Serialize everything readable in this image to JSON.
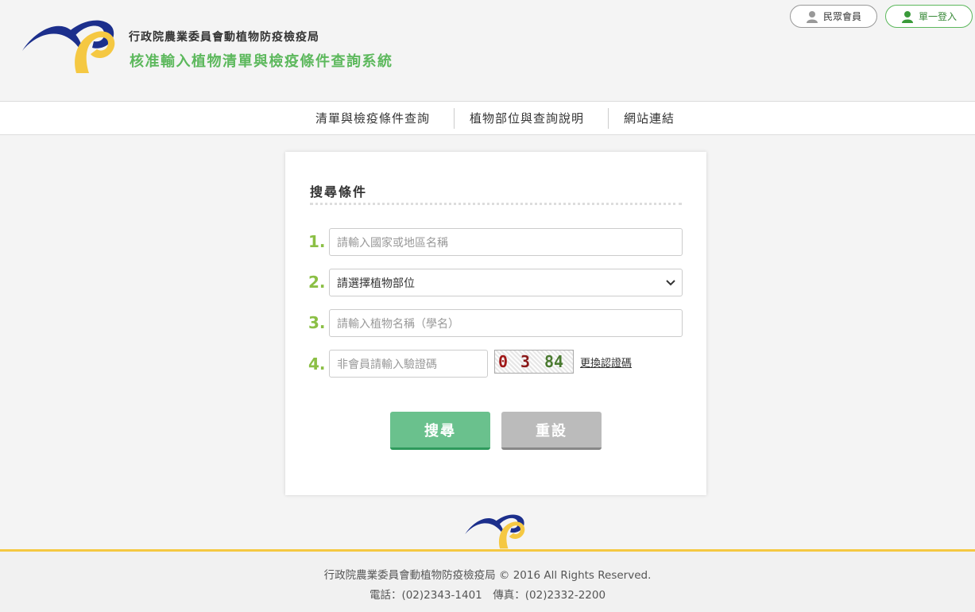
{
  "header": {
    "org_name": "行政院農業委員會動植物防疫檢疫局",
    "system_name": "核准輸入植物清單與檢疫條件查詢系統",
    "member_button": "民眾會員",
    "sso_button": "單一登入"
  },
  "nav": {
    "items": [
      "清單與檢疫條件查詢",
      "植物部位與查詢說明",
      "網站連結"
    ]
  },
  "search": {
    "title": "搜尋條件",
    "steps": [
      "1.",
      "2.",
      "3.",
      "4."
    ],
    "country_placeholder": "請輸入國家或地區名稱",
    "plant_part_selected": "請選擇植物部位",
    "plant_name_placeholder": "請輸入植物名稱（學名）",
    "captcha_placeholder": "非會員請輸入驗證碼",
    "captcha_chars": [
      "0",
      "3",
      "84"
    ],
    "refresh_captcha": "更換認證碼",
    "search_button": "搜尋",
    "reset_button": "重設"
  },
  "footer": {
    "copyright": "行政院農業委員會動植物防疫檢疫局 © 2016 All Rights Reserved.",
    "contact": "電話：(02)2343-1401　傳真：(02)2332-2200"
  },
  "colors": {
    "brand_green": "#5cb85c",
    "step_green": "#8bbf45",
    "search_button": "#6ac18d",
    "reset_button": "#bbbbbb",
    "footer_accent": "#f5c842",
    "logo_blue": "#1c2f8c",
    "logo_yellow": "#f5c842"
  }
}
